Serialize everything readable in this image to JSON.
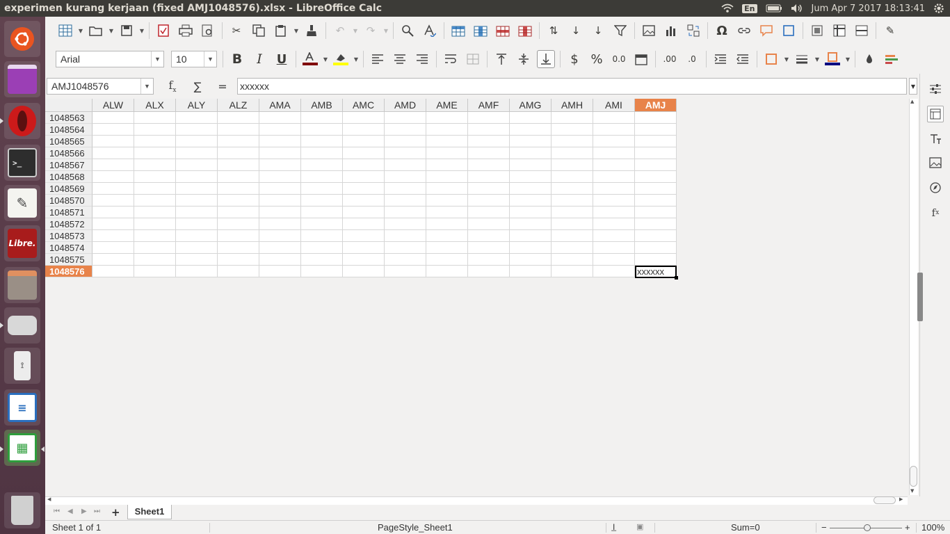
{
  "window": {
    "title": "experimen kurang kerjaan (fixed AMJ1048576).xlsx - LibreOffice Calc"
  },
  "tray": {
    "keyboard": "En",
    "clock": "Jum Apr  7 2017 18:13:41"
  },
  "launcher": {
    "items": [
      "ubuntu-dash-icon",
      "app-purple-icon",
      "opera-icon",
      "terminal-icon",
      "text-editor-icon",
      "projectlibre-icon",
      "files-icon",
      "disk-icon",
      "usb-icon",
      "writer-icon",
      "calc-icon",
      "trash-icon"
    ],
    "projectlibre_text": "Libre."
  },
  "format": {
    "font_name": "Arial",
    "font_size": "10"
  },
  "formula": {
    "name_box": "AMJ1048576",
    "fx": "f",
    "sum": "∑",
    "equals": "=",
    "content": "xxxxxx"
  },
  "grid": {
    "columns": [
      "ALW",
      "ALX",
      "ALY",
      "ALZ",
      "AMA",
      "AMB",
      "AMC",
      "AMD",
      "AME",
      "AMF",
      "AMG",
      "AMH",
      "AMI",
      "AMJ"
    ],
    "active_column": "AMJ",
    "rows": [
      "1048563",
      "1048564",
      "1048565",
      "1048566",
      "1048567",
      "1048568",
      "1048569",
      "1048570",
      "1048571",
      "1048572",
      "1048573",
      "1048574",
      "1048575",
      "1048576"
    ],
    "active_row": "1048576",
    "active_cell_value": "xxxxxx"
  },
  "sheets": {
    "tabs": [
      "Sheet1"
    ],
    "add": "+"
  },
  "status": {
    "sheet_of": "Sheet 1 of 1",
    "page_style": "PageStyle_Sheet1",
    "sum": "Sum=0",
    "zoom_minus": "−",
    "zoom_plus": "+",
    "zoom": "100%"
  },
  "colors": {
    "accent": "#e8834a",
    "panel": "#3c3b37"
  }
}
